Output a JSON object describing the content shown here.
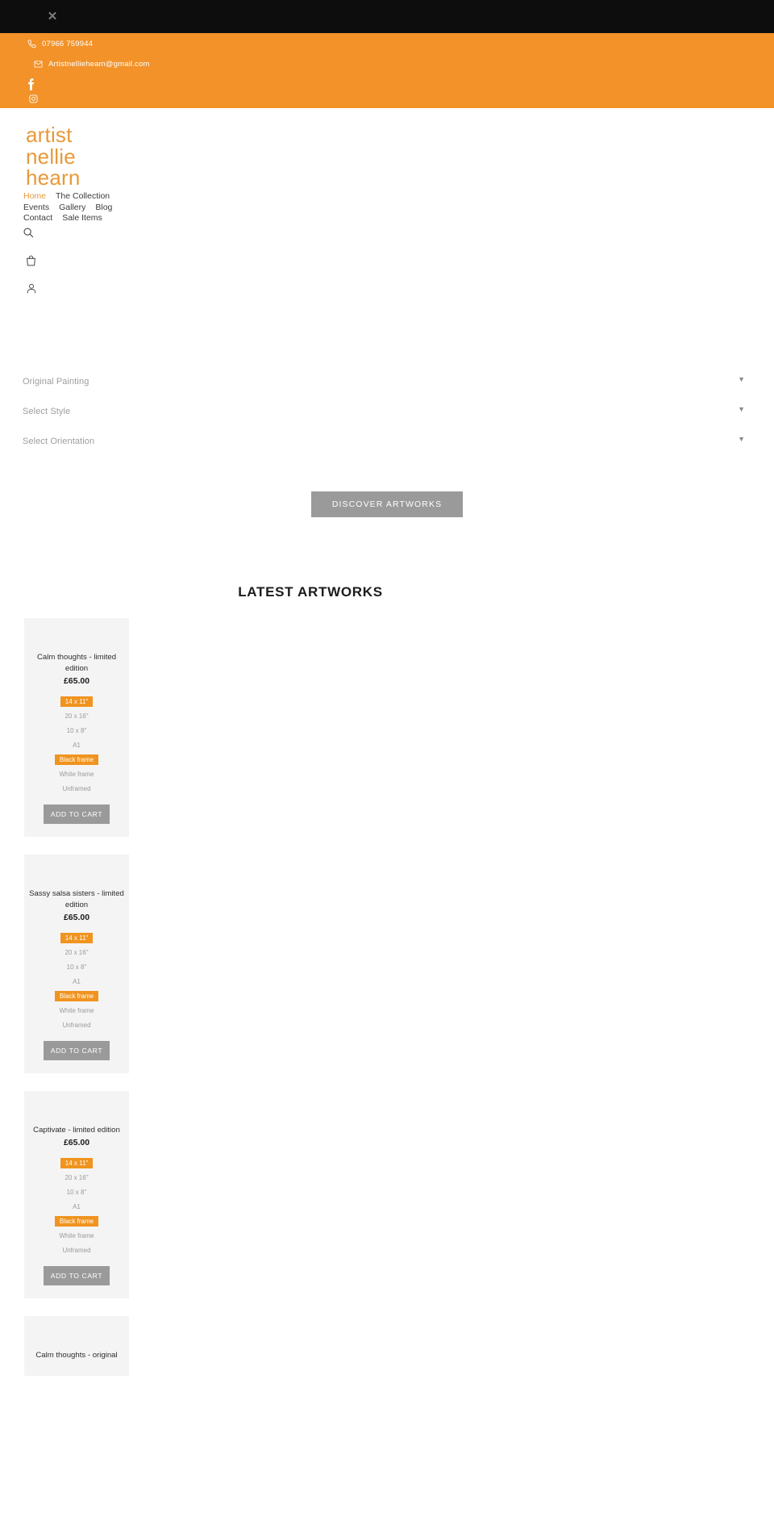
{
  "topbar": {
    "close_label": "✕"
  },
  "contact": {
    "phone": "07966 759944",
    "email": "Artistnellieheam@gmail.com",
    "social": [
      {
        "name": "facebook",
        "label": "f"
      },
      {
        "name": "instagram",
        "label": ""
      }
    ]
  },
  "brand": {
    "line1": "artist",
    "line2": "nellie",
    "line3": "hearn",
    "accent_color": "#e8993a"
  },
  "nav": {
    "items": [
      {
        "label": "Home",
        "active": true
      },
      {
        "label": "The Collection",
        "active": false
      },
      {
        "label": "Events",
        "active": false
      },
      {
        "label": "Gallery",
        "active": false
      },
      {
        "label": "Blog",
        "active": false
      },
      {
        "label": "Contact",
        "active": false
      },
      {
        "label": "Sale Items",
        "active": false
      }
    ]
  },
  "utility_icons": [
    {
      "name": "search-icon"
    },
    {
      "name": "shopping-bag-icon"
    },
    {
      "name": "account-icon"
    }
  ],
  "filters": {
    "rows": [
      {
        "label": "Original Painting",
        "caret": "▼"
      },
      {
        "label": "Select Style",
        "caret": "▼"
      },
      {
        "label": "Select Orientation",
        "caret": "▼"
      }
    ],
    "discover_label": "DISCOVER ARTWORKS"
  },
  "main": {
    "section_title": "LATEST ARTWORKS",
    "add_to_cart_label": "ADD TO CART",
    "products": [
      {
        "title": "Calm thoughts - limited edition",
        "price": "£65.00",
        "sizes": [
          {
            "label": "14 x 11\"",
            "selected": true
          },
          {
            "label": "20 x 16\"",
            "selected": false
          },
          {
            "label": "10 x 8\"",
            "selected": false
          },
          {
            "label": "A1",
            "selected": false
          }
        ],
        "frames": [
          {
            "label": "Black frame",
            "selected": true
          },
          {
            "label": "White frame",
            "selected": false
          },
          {
            "label": "Unframed",
            "selected": false
          }
        ]
      },
      {
        "title": "Sassy salsa sisters - limited edition",
        "price": "£65.00",
        "sizes": [
          {
            "label": "14 x 11\"",
            "selected": true
          },
          {
            "label": "20 x 16\"",
            "selected": false
          },
          {
            "label": "10 x 8\"",
            "selected": false
          },
          {
            "label": "A1",
            "selected": false
          }
        ],
        "frames": [
          {
            "label": "Black frame",
            "selected": true
          },
          {
            "label": "White frame",
            "selected": false
          },
          {
            "label": "Unframed",
            "selected": false
          }
        ]
      },
      {
        "title": "Captivate - limited edition",
        "price": "£65.00",
        "sizes": [
          {
            "label": "14 x 11\"",
            "selected": true
          },
          {
            "label": "20 x 16\"",
            "selected": false
          },
          {
            "label": "10 x 8\"",
            "selected": false
          },
          {
            "label": "A1",
            "selected": false
          }
        ],
        "frames": [
          {
            "label": "Black frame",
            "selected": true
          },
          {
            "label": "White frame",
            "selected": false
          },
          {
            "label": "Unframed",
            "selected": false
          }
        ]
      },
      {
        "title": "Calm thoughts - original",
        "price": "",
        "sizes": [],
        "frames": []
      }
    ]
  }
}
